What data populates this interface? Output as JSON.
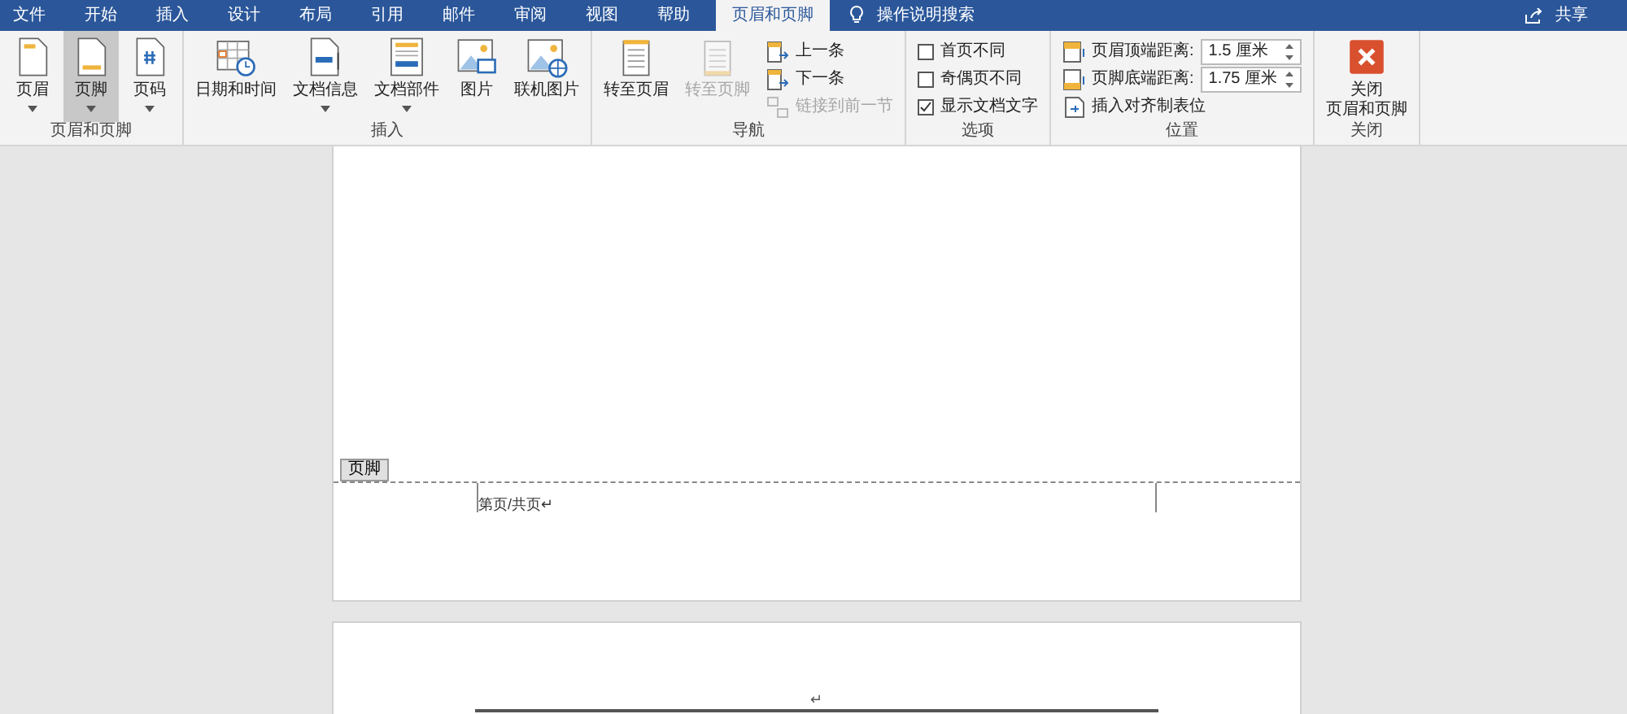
{
  "tabs": [
    {
      "label": "文件",
      "selected": false
    },
    {
      "label": "开始",
      "selected": false
    },
    {
      "label": "插入",
      "selected": false
    },
    {
      "label": "设计",
      "selected": false
    },
    {
      "label": "布局",
      "selected": false
    },
    {
      "label": "引用",
      "selected": false
    },
    {
      "label": "邮件",
      "selected": false
    },
    {
      "label": "审阅",
      "selected": false
    },
    {
      "label": "视图",
      "selected": false
    },
    {
      "label": "帮助",
      "selected": false
    },
    {
      "label": "页眉和页脚",
      "selected": true
    }
  ],
  "tell_me": "操作说明搜索",
  "share": "共享",
  "groups": [
    {
      "label": "页眉和页脚",
      "items": [
        {
          "kind": "large",
          "label": "页眉",
          "dropdown": true,
          "selected": false,
          "disabled": false
        },
        {
          "kind": "large",
          "label": "页脚",
          "dropdown": true,
          "selected": true,
          "disabled": false
        },
        {
          "kind": "large",
          "label": "页码",
          "dropdown": true,
          "selected": false,
          "disabled": false
        }
      ]
    },
    {
      "label": "插入",
      "items": [
        {
          "kind": "large",
          "label": "日期和时间",
          "dropdown": false,
          "selected": false,
          "disabled": false
        },
        {
          "kind": "large",
          "label": "文档信息",
          "dropdown": true,
          "selected": false,
          "disabled": false
        },
        {
          "kind": "large",
          "label": "文档部件",
          "dropdown": true,
          "selected": false,
          "disabled": false
        },
        {
          "kind": "large",
          "label": "图片",
          "dropdown": false,
          "selected": false,
          "disabled": false
        },
        {
          "kind": "large",
          "label": "联机图片",
          "dropdown": false,
          "selected": false,
          "disabled": false
        }
      ]
    },
    {
      "label": "导航",
      "items": [
        {
          "kind": "large",
          "label": "转至页眉",
          "dropdown": false,
          "selected": false,
          "disabled": false
        },
        {
          "kind": "large",
          "label": "转至页脚",
          "dropdown": false,
          "selected": false,
          "disabled": true
        },
        {
          "kind": "stack",
          "items": [
            {
              "kind": "small",
              "label": "上一条",
              "disabled": false
            },
            {
              "kind": "small",
              "label": "下一条",
              "disabled": false
            },
            {
              "kind": "small",
              "label": "链接到前一节",
              "disabled": true
            }
          ]
        }
      ]
    },
    {
      "label": "选项",
      "items": [
        {
          "kind": "stack",
          "items": [
            {
              "kind": "checkbox",
              "label": "首页不同",
              "checked": false
            },
            {
              "kind": "checkbox",
              "label": "奇偶页不同",
              "checked": false
            },
            {
              "kind": "checkbox",
              "label": "显示文档文字",
              "checked": true
            }
          ]
        }
      ]
    },
    {
      "label": "位置",
      "items": [
        {
          "kind": "stack",
          "items": [
            {
              "kind": "spin",
              "label": "页眉顶端距离:",
              "value": "1.5 厘米"
            },
            {
              "kind": "spin",
              "label": "页脚底端距离:",
              "value": "1.75 厘米"
            },
            {
              "kind": "small",
              "label": "插入对齐制表位",
              "disabled": false
            }
          ]
        }
      ]
    },
    {
      "label": "关闭",
      "items": [
        {
          "kind": "large",
          "lines": [
            "关闭",
            "页眉和页脚"
          ],
          "dropdown": false,
          "selected": false,
          "disabled": false
        }
      ]
    }
  ],
  "document": {
    "footer_tag": "页脚",
    "footer_text": "第页/共页↵",
    "next_page_mark": "↵"
  }
}
